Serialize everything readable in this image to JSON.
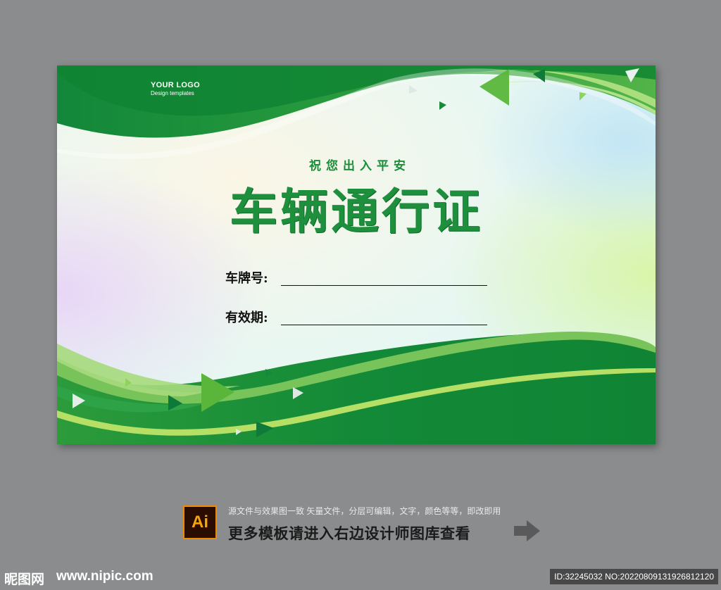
{
  "card": {
    "logo_title": "YOUR LOGO",
    "logo_subtitle": "Design templates",
    "subtitle": "祝您出入平安",
    "title": "车辆通行证",
    "fields": [
      {
        "label": "车牌号:"
      },
      {
        "label": "有效期:"
      }
    ],
    "colors": {
      "dark_green": "#0c8a32",
      "mid_green": "#3aa33c",
      "light_green": "#8fd36a"
    }
  },
  "footer": {
    "icon": "Ai",
    "line1": "源文件与效果图一致 矢量文件，分层可编辑，文字，颜色等等，即改即用",
    "line2": "更多模板请进入右边设计师图库查看"
  },
  "watermark": {
    "logo": "昵图网",
    "url": "www.nipic.com",
    "id": "ID:32245032 NO:20220809131926812120"
  }
}
